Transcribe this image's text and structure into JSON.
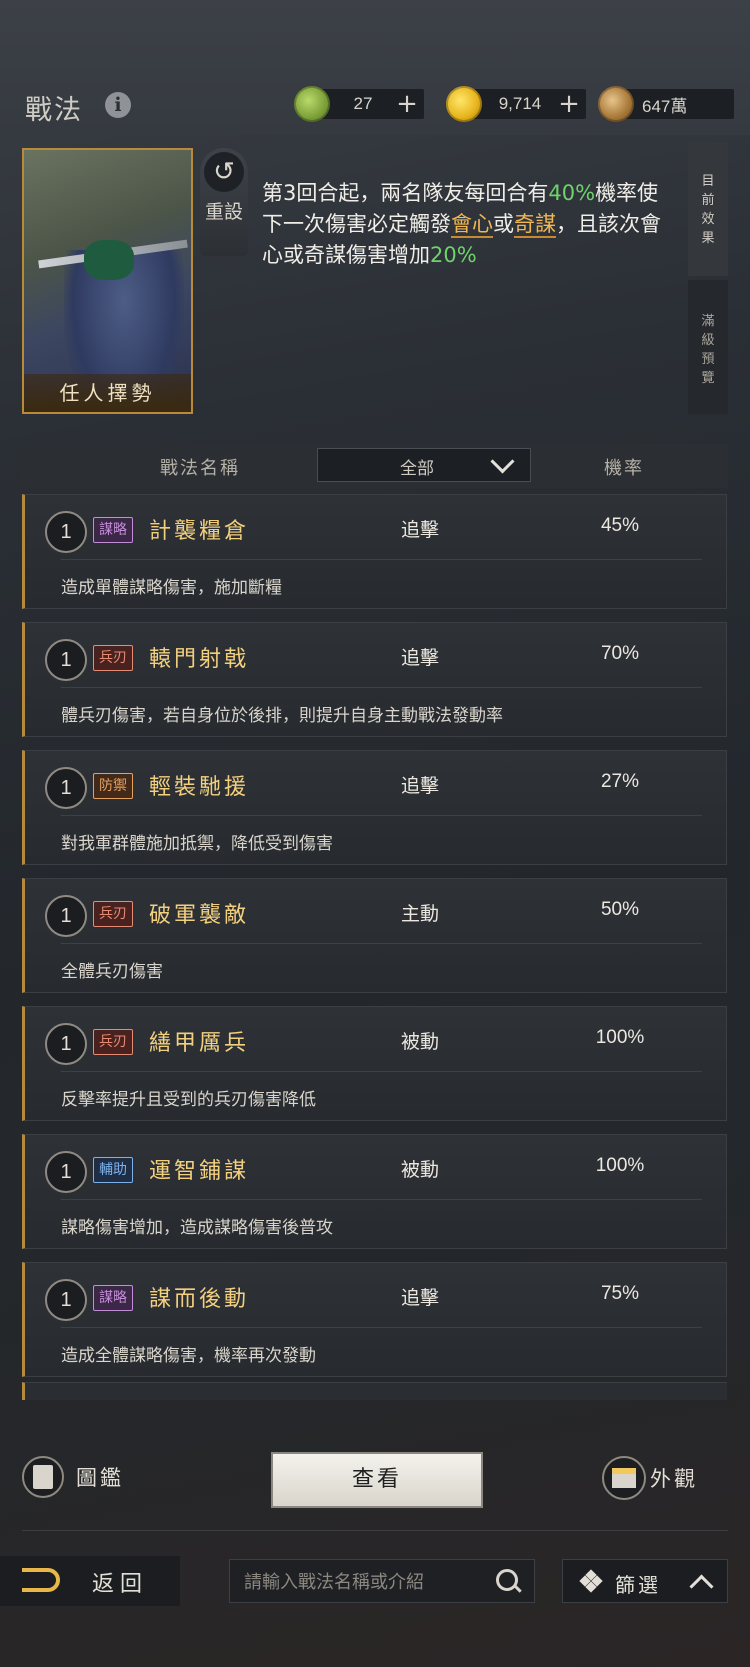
{
  "header": {
    "title": "戰法",
    "info_icon": "info-icon",
    "resources": [
      {
        "icon": "jade-coin-icon",
        "value": "27"
      },
      {
        "icon": "gold-coin-icon",
        "value": "9,714"
      },
      {
        "icon": "copper-coin-icon",
        "value": "647萬"
      }
    ]
  },
  "skill": {
    "card_name": "任人擇勢",
    "reset_label": "重設",
    "description": {
      "p1": "第3回合起，兩名隊友每回合有",
      "g1": "40%",
      "p2": "機率使下一次傷害必定觸發",
      "o1": "會心",
      "p3": "或",
      "o2": "奇謀",
      "p4": "，且該次會心或奇謀傷害增加",
      "g2": "20%"
    },
    "side_tabs": [
      "目前效果",
      "滿級預覽"
    ]
  },
  "table": {
    "col_name": "戰法名稱",
    "filter_value": "全部",
    "col_rate": "機率"
  },
  "rows": [
    {
      "level": "1",
      "tag": "謀略",
      "name": "計襲糧倉",
      "type": "追擊",
      "rate": "45%",
      "desc": "造成單體謀略傷害，施加斷糧"
    },
    {
      "level": "1",
      "tag": "兵刃",
      "name": "轅門射戟",
      "type": "追擊",
      "rate": "70%",
      "desc": "體兵刃傷害，若自身位於後排，則提升自身主動戰法發動率"
    },
    {
      "level": "1",
      "tag": "防禦",
      "name": "輕裝馳援",
      "type": "追擊",
      "rate": "27%",
      "desc": "對我軍群體施加抵禦，降低受到傷害"
    },
    {
      "level": "1",
      "tag": "兵刃",
      "name": "破軍襲敵",
      "type": "主動",
      "rate": "50%",
      "desc": "全體兵刃傷害"
    },
    {
      "level": "1",
      "tag": "兵刃",
      "name": "繕甲厲兵",
      "type": "被動",
      "rate": "100%",
      "desc": "反擊率提升且受到的兵刃傷害降低"
    },
    {
      "level": "1",
      "tag": "輔助",
      "name": "運智鋪謀",
      "type": "被動",
      "rate": "100%",
      "desc": "謀略傷害增加，造成謀略傷害後普攻"
    },
    {
      "level": "1",
      "tag": "謀略",
      "name": "謀而後動",
      "type": "追擊",
      "rate": "75%",
      "desc": "造成全體謀略傷害，機率再次發動"
    }
  ],
  "actions": {
    "tujian_label": "圖鑑",
    "view_label": "查看",
    "waiguan_label": "外觀"
  },
  "footer": {
    "back_label": "返回",
    "search_placeholder": "請輸入戰法名稱或介紹",
    "filter_label": "篩選"
  }
}
